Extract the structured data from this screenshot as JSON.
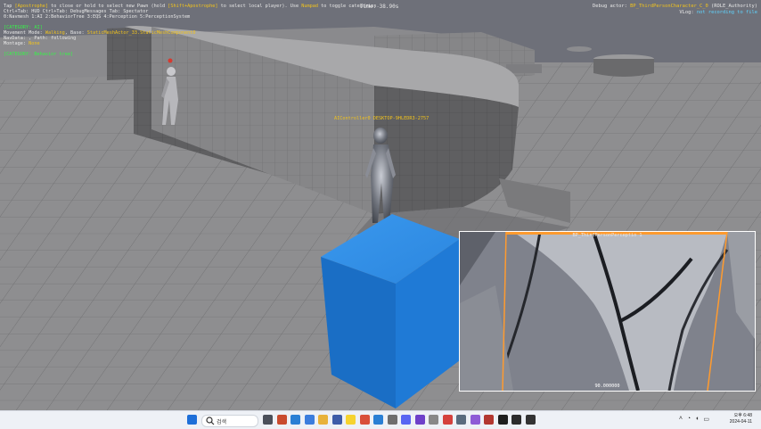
{
  "hud": {
    "lines": [
      {
        "parts": [
          {
            "text": "Tap ",
            "color": "white"
          },
          {
            "text": "[Apostrophe]",
            "color": "yellow"
          },
          {
            "text": " to close or hold to select new Pawn (hold ",
            "color": "white"
          },
          {
            "text": "[Shift+Apostrophe]",
            "color": "yellow"
          },
          {
            "text": " to select local player). Use ",
            "color": "white"
          },
          {
            "text": "Numpad",
            "color": "yellow"
          },
          {
            "text": " to toggle categories.",
            "color": "white"
          }
        ]
      },
      {
        "parts": [
          {
            "text": "Ctrl+Tab: HUD  Ctrl+Tab: DebugMessages  Tab: Spectator",
            "color": "white"
          }
        ]
      },
      {
        "parts": [
          {
            "text": "0:Navmesh  1:AI  2:BehaviorTree  3:EQS  4:Perception  5:PerceptionSystem",
            "color": "white"
          }
        ]
      },
      {
        "parts": [
          {
            "text": "",
            "color": "white"
          }
        ]
      },
      {
        "parts": [
          {
            "text": "[CATEGORY: AI]",
            "color": "green"
          }
        ]
      },
      {
        "parts": [
          {
            "text": "Movement Mode: ",
            "color": "white"
          },
          {
            "text": "Walking",
            "color": "yellow"
          },
          {
            "text": ", Base: ",
            "color": "white"
          },
          {
            "text": "StaticMeshActor_33.StaticMeshComponent0",
            "color": "yellow"
          }
        ]
      },
      {
        "parts": [
          {
            "text": "NavData: ",
            "color": "white"
          },
          {
            "text": ", Path: following",
            "color": "white"
          }
        ]
      },
      {
        "parts": [
          {
            "text": "Montage: ",
            "color": "white"
          },
          {
            "text": "None",
            "color": "yellow"
          }
        ]
      },
      {
        "parts": [
          {
            "text": "",
            "color": "white"
          }
        ]
      },
      {
        "parts": [
          {
            "text": "[CATEGORY: Behavior tree]",
            "color": "green"
          }
        ]
      }
    ],
    "time": "Time: 38.90s",
    "debug_actor_prefix": "Debug actor: ",
    "debug_actor_name": "BP_ThirdPersonCharacter_C_0",
    "debug_actor_role": " (ROLE_Authority)",
    "vlog_prefix": "VLog: ",
    "vlog_status": "not recording to file",
    "ai_label": "AIController0 DESKTOP-9HLEDR3-2757"
  },
  "preview": {
    "title": "BP_ThirdPersonPerceptio 1",
    "fov": "90.000000"
  },
  "taskbar": {
    "search_placeholder": "검색",
    "icons": [
      {
        "name": "windows-start-icon",
        "color": "#1e6fd8"
      },
      {
        "name": "task-view-icon",
        "color": "#4a4f5a"
      },
      {
        "name": "photos-app-icon",
        "color": "#c94b2e"
      },
      {
        "name": "edge-app-icon",
        "color": "#2a7fd4"
      },
      {
        "name": "mail-app-icon",
        "color": "#3b7ddd"
      },
      {
        "name": "file-explorer-icon",
        "color": "#e8b23a"
      },
      {
        "name": "store-app-icon",
        "color": "#3d5ca8"
      },
      {
        "name": "kakaotalk-icon",
        "color": "#f6d32f"
      },
      {
        "name": "chrome-icon",
        "color": "#d94f3a"
      },
      {
        "name": "visual-studio-code-icon",
        "color": "#2a7fd4"
      },
      {
        "name": "notes-app-icon",
        "color": "#6e6e6e"
      },
      {
        "name": "discord-icon",
        "color": "#5865f2"
      },
      {
        "name": "github-desktop-icon",
        "color": "#6e40c9"
      },
      {
        "name": "tool-app-icon",
        "color": "#888888"
      },
      {
        "name": "media-app-icon",
        "color": "#d5413c"
      },
      {
        "name": "dev-app-icon",
        "color": "#5a6b7d"
      },
      {
        "name": "visual-studio-icon",
        "color": "#8e5bd6"
      },
      {
        "name": "terminal-app-icon",
        "color": "#b3372f"
      },
      {
        "name": "unreal-engine-icon",
        "color": "#1e1e1e"
      },
      {
        "name": "unreal-editor-icon",
        "color": "#2c2c2c"
      },
      {
        "name": "record-app-icon",
        "color": "#333333"
      }
    ],
    "clock_time": "오후 6:48",
    "clock_date": "2024-04-11"
  },
  "colors": {
    "sky": "#6e7079",
    "floor": "#8f8f90",
    "cube": "#1f7ad6",
    "hud_green": "#38f24a",
    "hud_yellow": "#f2c31d",
    "hud_cyan": "#5fd4ff",
    "preview_border": "#ff9b2f"
  }
}
